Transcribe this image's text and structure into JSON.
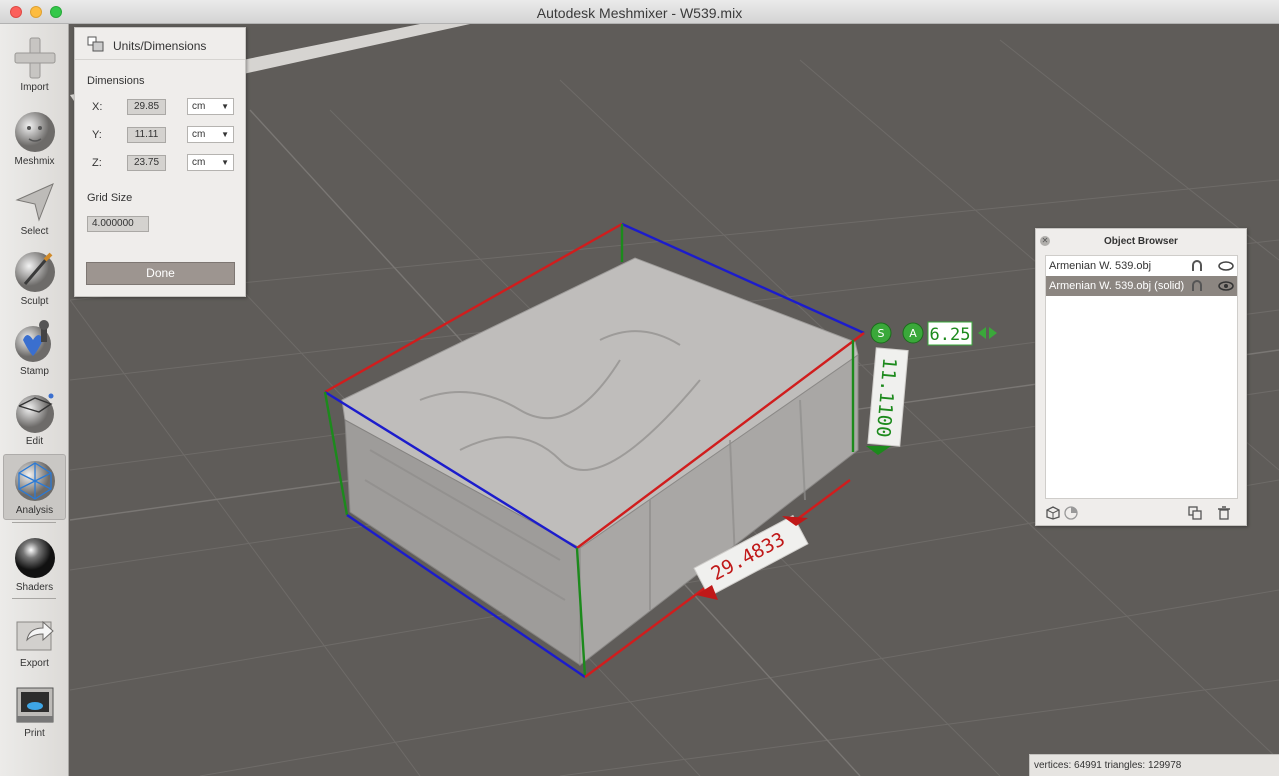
{
  "window": {
    "title": "Autodesk Meshmixer - W539.mix"
  },
  "toolbar": {
    "items": [
      {
        "label": "Import"
      },
      {
        "label": "Meshmix"
      },
      {
        "label": "Select"
      },
      {
        "label": "Sculpt"
      },
      {
        "label": "Stamp"
      },
      {
        "label": "Edit"
      },
      {
        "label": "Analysis",
        "active": true
      },
      {
        "label": "Shaders"
      },
      {
        "label": "Export"
      },
      {
        "label": "Print"
      }
    ]
  },
  "units_panel": {
    "title": "Units/Dimensions",
    "dimensions_heading": "Dimensions",
    "dims": [
      {
        "axis": "X:",
        "value": "29.85",
        "unit": "cm"
      },
      {
        "axis": "Y:",
        "value": "11.11",
        "unit": "cm"
      },
      {
        "axis": "Z:",
        "value": "23.75",
        "unit": "cm"
      }
    ],
    "grid_heading": "Grid Size",
    "grid_value": "4.000000",
    "done_label": "Done"
  },
  "viewport": {
    "scale_badge_s": "S",
    "scale_badge_a": "A",
    "scale_value": "6.25",
    "height_dim_label": "11.1100",
    "width_dim_label": "29.4833",
    "colors": {
      "x_axis": "#d01d1d",
      "y_axis": "#1c8a1c",
      "z_axis": "#1c1ccc",
      "background": "#5f5c59"
    }
  },
  "object_browser": {
    "title": "Object Browser",
    "objects": [
      {
        "name": "Armenian W. 539.obj",
        "selected": false
      },
      {
        "name": "Armenian W. 539.obj (solid)",
        "selected": true
      }
    ]
  },
  "status": {
    "text": "vertices: 64991 triangles: 129978"
  }
}
